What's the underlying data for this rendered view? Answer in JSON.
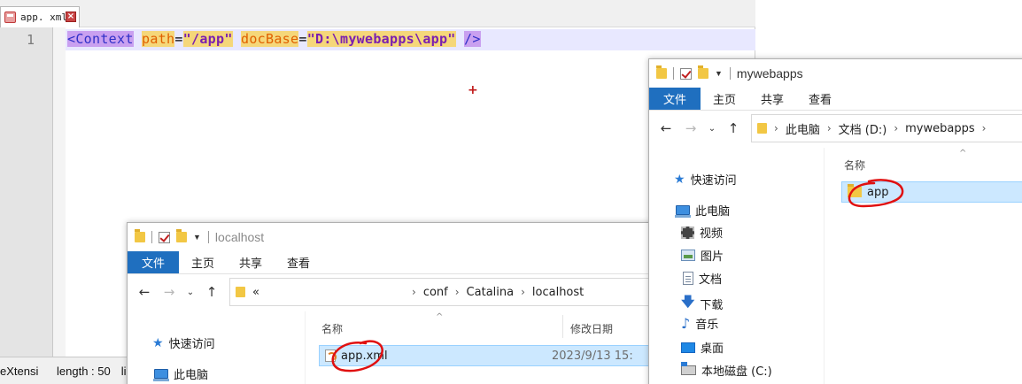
{
  "editor": {
    "tab_label": "app. xml",
    "tab_close_glyph": "×",
    "line_number": "1",
    "code": {
      "tag_open": "<Context",
      "attr1_name": "path",
      "eq1": "=",
      "attr1_value": "\"/app\"",
      "attr2_name": "docBase",
      "eq2": "=",
      "attr2_value": "\"D:\\mywebapps\\app\"",
      "tag_close": "/>"
    },
    "cursor_glyph": "+",
    "status": {
      "language": "eXtensi",
      "length": "length : 50",
      "line": "line"
    },
    "colors": {
      "tag_bg": "#c9a0f0",
      "attr_bg": "#f5d77a",
      "attr_text": "#e06000",
      "value_text": "#7a1fb0",
      "current_line_bg": "#e8e8ff"
    }
  },
  "explorer_localhost": {
    "title": "localhost",
    "ribbon": [
      "文件",
      "主页",
      "共享",
      "查看"
    ],
    "nav": {
      "back": "←",
      "forward": "→",
      "recent": "⌄",
      "up": "↑"
    },
    "address": {
      "overflow": "«",
      "crumbs": [
        "conf",
        "Catalina",
        "localhost"
      ]
    },
    "sidebar": [
      "快速访问",
      "此电脑"
    ],
    "columns": {
      "name": "名称",
      "date": "修改日期"
    },
    "files": [
      {
        "name": "app.xml",
        "date": "2023/9/13 15:",
        "icon": "xml-file-icon"
      }
    ]
  },
  "explorer_mywebapps": {
    "title": "mywebapps",
    "ribbon": [
      "文件",
      "主页",
      "共享",
      "查看"
    ],
    "nav": {
      "back": "←",
      "forward": "→",
      "recent": "⌄",
      "up": "↑"
    },
    "address": {
      "crumbs": [
        "此电脑",
        "文档 (D:)",
        "mywebapps"
      ]
    },
    "sidebar": [
      "快速访问",
      "此电脑",
      "视频",
      "图片",
      "文档",
      "下载",
      "音乐",
      "桌面",
      "本地磁盘 (C:)"
    ],
    "columns": {
      "name": "名称"
    },
    "files": [
      {
        "name": "app",
        "icon": "folder-icon"
      }
    ]
  },
  "colors": {
    "ribbon_file_tab": "#1f6fbf",
    "selection_bg": "#cce8ff",
    "annotation_red": "#e01010"
  }
}
